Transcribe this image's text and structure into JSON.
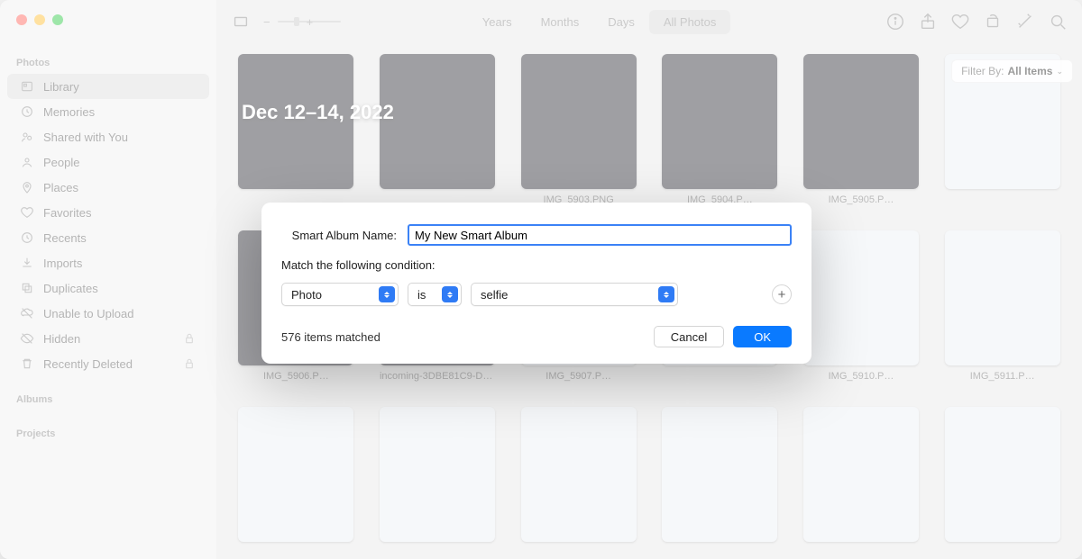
{
  "sidebar": {
    "sections": {
      "photos": "Photos",
      "albums": "Albums",
      "projects": "Projects"
    },
    "items": [
      {
        "label": "Library",
        "icon": "library",
        "selected": true
      },
      {
        "label": "Memories",
        "icon": "clock"
      },
      {
        "label": "Shared with You",
        "icon": "shared"
      },
      {
        "label": "People",
        "icon": "person"
      },
      {
        "label": "Places",
        "icon": "pin"
      },
      {
        "label": "Favorites",
        "icon": "heart"
      },
      {
        "label": "Recents",
        "icon": "clock"
      },
      {
        "label": "Imports",
        "icon": "download"
      },
      {
        "label": "Duplicates",
        "icon": "stack"
      },
      {
        "label": "Unable to Upload",
        "icon": "cloud-slash"
      },
      {
        "label": "Hidden",
        "icon": "eye-slash",
        "locked": true
      },
      {
        "label": "Recently Deleted",
        "icon": "trash",
        "locked": true
      }
    ]
  },
  "toolbar": {
    "views": [
      "Years",
      "Months",
      "Days",
      "All Photos"
    ],
    "active_view": "All Photos",
    "filter_prefix": "Filter By:",
    "filter_value": "All Items"
  },
  "content": {
    "date_header": "Dec 12–14, 2022",
    "thumbs": [
      {
        "label": "",
        "light": false
      },
      {
        "label": "",
        "light": false
      },
      {
        "label": "IMG_5903.PNG",
        "light": false
      },
      {
        "label": "IMG_5904.P…",
        "light": false
      },
      {
        "label": "IMG_5905.P…",
        "light": false
      },
      {
        "label": "",
        "light": true
      },
      {
        "label": "IMG_5906.P…",
        "light": false
      },
      {
        "label": "incoming-3DBE81C9-DE…",
        "light": false
      },
      {
        "label": "IMG_5907.P…",
        "light": true
      },
      {
        "label": "",
        "light": true
      },
      {
        "label": "IMG_5910.P…",
        "light": true
      },
      {
        "label": "IMG_5911.P…",
        "light": true
      },
      {
        "label": "",
        "light": true
      },
      {
        "label": "",
        "light": true
      },
      {
        "label": "",
        "light": true
      },
      {
        "label": "",
        "light": true
      },
      {
        "label": "",
        "light": true
      },
      {
        "label": "",
        "light": true
      }
    ]
  },
  "modal": {
    "name_label": "Smart Album Name:",
    "name_value": "My New Smart Album",
    "match_label": "Match the following condition:",
    "cond_field": "Photo",
    "cond_op": "is",
    "cond_value": "selfie",
    "matched_text": "576 items matched",
    "cancel": "Cancel",
    "ok": "OK"
  }
}
